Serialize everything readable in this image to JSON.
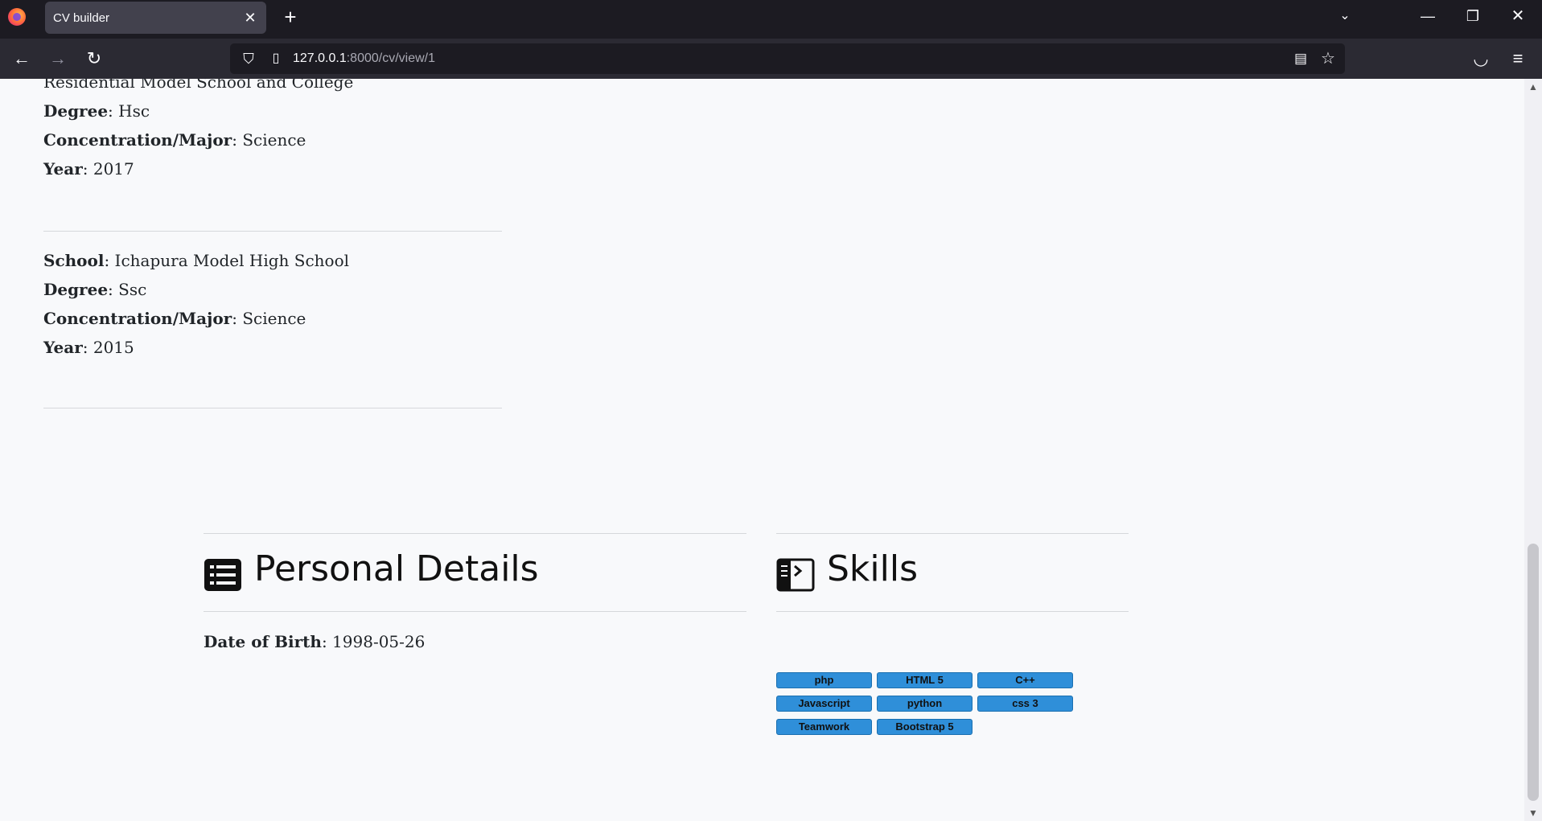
{
  "browser": {
    "tab_title": "CV builder",
    "url_host": "127.0.0.1",
    "url_path": ":8000/cv/view/1"
  },
  "education": {
    "first_school_partial": "Residential Model School and College",
    "entry1": {
      "degree_label": "Degree",
      "degree_value": ": Hsc",
      "major_label": "Concentration/Major",
      "major_value": ": Science",
      "year_label": "Year",
      "year_value": ": 2017"
    },
    "entry2": {
      "school_label": "School",
      "school_value": ": Ichapura Model High School",
      "degree_label": "Degree",
      "degree_value": ": Ssc",
      "major_label": "Concentration/Major",
      "major_value": ": Science",
      "year_label": "Year",
      "year_value": ": 2015"
    }
  },
  "personal": {
    "title": "Personal Details",
    "icon": "list-icon",
    "dob_label": "Date of Birth",
    "dob_value": ": 1998-05-26"
  },
  "skills": {
    "title": "Skills",
    "icon": "terminal-sidebar-icon",
    "chip_color": "#2f8fd9",
    "items": [
      "php",
      "HTML 5",
      "C++",
      "Javascript",
      "python",
      "css 3",
      "Teamwork",
      "Bootstrap 5"
    ]
  }
}
